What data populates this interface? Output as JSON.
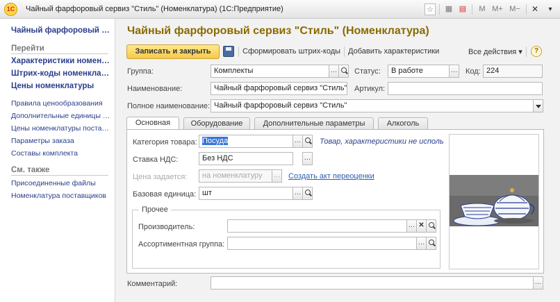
{
  "window": {
    "title": "Чайный фарфоровый сервиз \"Стиль\" (Номенклатура)  (1С:Предприятие)",
    "logo": "1С",
    "controls": [
      "M",
      "M+",
      "M−"
    ]
  },
  "sidebar": {
    "current": "Чайный фарфоровый сервиз \"Стиль\"",
    "go_header": "Перейти",
    "go_items": [
      "Характеристики номенклатуры",
      "Штрих-коды номенклатуры",
      "Цены номенклатуры"
    ],
    "more_items": [
      "Правила ценообразования",
      "Дополнительные единицы измерения",
      "Цены номенклатуры поставщиков",
      "Параметры заказа",
      "Составы комплекта"
    ],
    "see_also_header": "См. также",
    "see_also_items": [
      "Присоединенные файлы",
      "Номенклатура поставщиков"
    ]
  },
  "header": {
    "title": "Чайный фарфоровый сервиз \"Стиль\" (Номенклатура)"
  },
  "toolbar": {
    "save_close": "Записать и закрыть",
    "barcodes": "Сформировать штрих-коды",
    "add_characteristics": "Добавить характеристики",
    "all_actions": "Все действия ▾",
    "help": "?"
  },
  "form": {
    "group_label": "Группа:",
    "group_value": "Комплекты",
    "status_label": "Статус:",
    "status_value": "В работе",
    "code_label": "Код:",
    "code_value": "224",
    "name_label": "Наименование:",
    "name_value": "Чайный фарфоровый сервиз \"Стиль\"",
    "article_label": "Артикул:",
    "article_value": "",
    "full_name_label": "Полное наименование:",
    "full_name_value": "Чайный фарфоровый сервиз \"Стиль\"",
    "comment_label": "Комментарий:",
    "comment_value": ""
  },
  "tabs": [
    "Основная",
    "Оборудование",
    "Дополнительные параметры",
    "Алкоголь"
  ],
  "main_tab": {
    "category_label": "Категория товара:",
    "category_value": "Посуда",
    "category_hint": "Товар, характеристики не используются",
    "vat_label": "Ставка НДС:",
    "vat_value": "Без НДС",
    "price_label": "Цена задается:",
    "price_value": "на номенклатуру",
    "revaluation_link": "Создать акт переоценки",
    "unit_label": "Базовая единица:",
    "unit_value": "шт",
    "other_group": "Прочее",
    "manufacturer_label": "Производитель:",
    "manufacturer_value": "",
    "assortment_label": "Ассортиментная группа:",
    "assortment_value": ""
  },
  "icons": {
    "select": "…",
    "search": "search-icon",
    "clear": "✕"
  }
}
